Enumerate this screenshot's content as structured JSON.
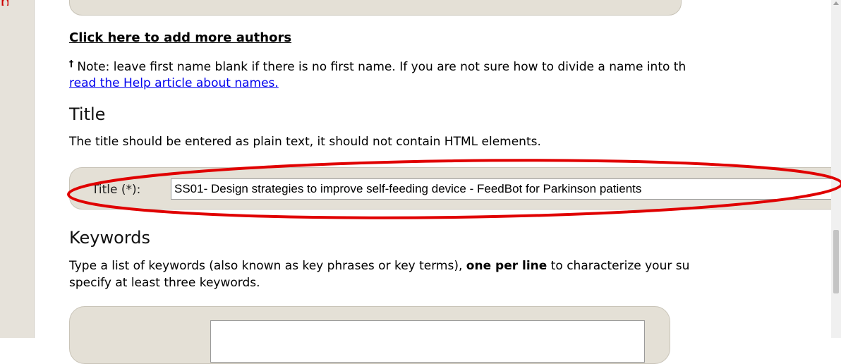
{
  "authors": {
    "add_more_label": "Click here to add more authors",
    "note_dagger": "†",
    "note_text": " Note: leave first name blank if there is no first name. If you are not sure how to divide a name into th",
    "help_link": "read the Help article about names."
  },
  "title_section": {
    "heading": "Title",
    "description": "The title should be entered as plain text, it should not contain HTML elements.",
    "field_label": "Title (*):",
    "field_value": "SS01- Design strategies to improve self-feeding device - FeedBot for Parkinson patients"
  },
  "keywords_section": {
    "heading": "Keywords",
    "desc_part1": "Type a list of keywords (also known as key phrases or key terms), ",
    "desc_bold": "one per line",
    "desc_part2": " to characterize your su",
    "desc_line2": "specify at least three keywords.",
    "textarea_value": ""
  },
  "colors": {
    "annotation_red": "#e00000",
    "panel_bg": "#e4e0d6",
    "link_blue": "#0000ee"
  },
  "icons": {
    "scroll_up": "scroll-up-arrow-icon",
    "corner_mark": "red-corner-mark-icon"
  }
}
